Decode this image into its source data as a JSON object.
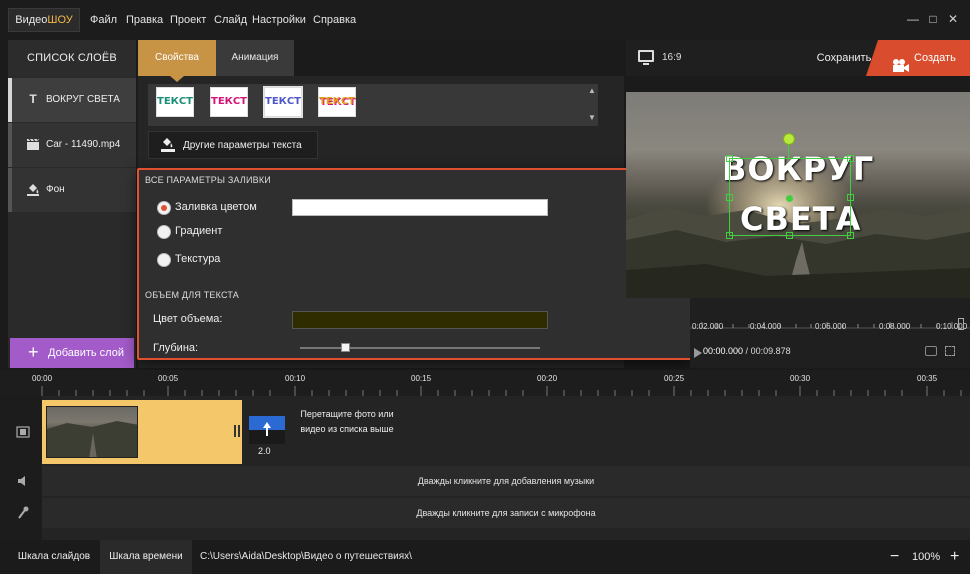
{
  "menubar": {
    "logo_part1": "Видео",
    "logo_part2": "ШОУ",
    "items": [
      "Файл",
      "Правка",
      "Проект",
      "Слайд",
      "Настройки",
      "Справка"
    ],
    "window_controls": [
      "minimize-icon",
      "maximize-icon",
      "close-icon"
    ]
  },
  "layers": {
    "header": "СПИСОК СЛОЁВ",
    "items": [
      {
        "icon": "text-icon",
        "label": "ВОКРУГ СВЕТА"
      },
      {
        "icon": "clapper-icon",
        "label": "Car - 11490.mp4"
      },
      {
        "icon": "paint-bucket-icon",
        "label": "Фон"
      }
    ],
    "add_button": "Добавить слой"
  },
  "tabs": {
    "properties": "Свойства",
    "animation": "Анимация"
  },
  "presets": [
    "ТЕКСТ",
    "ТЕКСТ",
    "ТЕКСТ",
    "ТЕКСТ"
  ],
  "more_text_button": "Другие параметры текста",
  "fill_popup": {
    "title": "ВСЕ ПАРАМЕТРЫ ЗАЛИВКИ",
    "options": [
      "Заливка цветом",
      "Градиент",
      "Текстура"
    ],
    "selected_option": "Заливка цветом",
    "fill_color": "#ffffff",
    "volume_title": "ОБЪЕМ ДЛЯ ТЕКСТА",
    "volume_color_label": "Цвет объема:",
    "volume_color": "#2f2d00",
    "depth_label": "Глубина:",
    "depth_value": 0.17
  },
  "preview": {
    "aspect": "16:9",
    "save_label": "Сохранить",
    "create_label": "Создать",
    "overlay_line1": "ВОКРУГ",
    "overlay_line2": "СВЕТА",
    "ruler_ticks": [
      "0:02.000",
      "0:04.000",
      "0:06.000",
      "0:08.000",
      "0:10.000"
    ],
    "timecode_current": "00:00.000",
    "timecode_total": "00:09.878"
  },
  "timeline": {
    "ticks": [
      "00:00",
      "00:05",
      "00:10",
      "00:15",
      "00:20",
      "00:25",
      "00:30",
      "00:35"
    ],
    "transition_duration": "2.0",
    "dropzone_text": "Перетащите фото или видео из списка выше",
    "music_hint": "Дважды кликните для добавления музыки",
    "mic_hint": "Дважды кликните для записи с микрофона"
  },
  "statusbar": {
    "tab_slides": "Шкала слайдов",
    "tab_timeline": "Шкала времени",
    "filepath": "C:\\Users\\Aida\\Desktop\\Видео о путешествиях\\",
    "zoom_out": "−",
    "zoom_level": "100%",
    "zoom_in": "+"
  },
  "colors": {
    "accent_orange": "#d94c2d",
    "tab_gold": "#c79445",
    "add_purple": "#a25bc8",
    "clip_yellow": "#f4c76b",
    "selection_green": "#3fcf3f"
  }
}
